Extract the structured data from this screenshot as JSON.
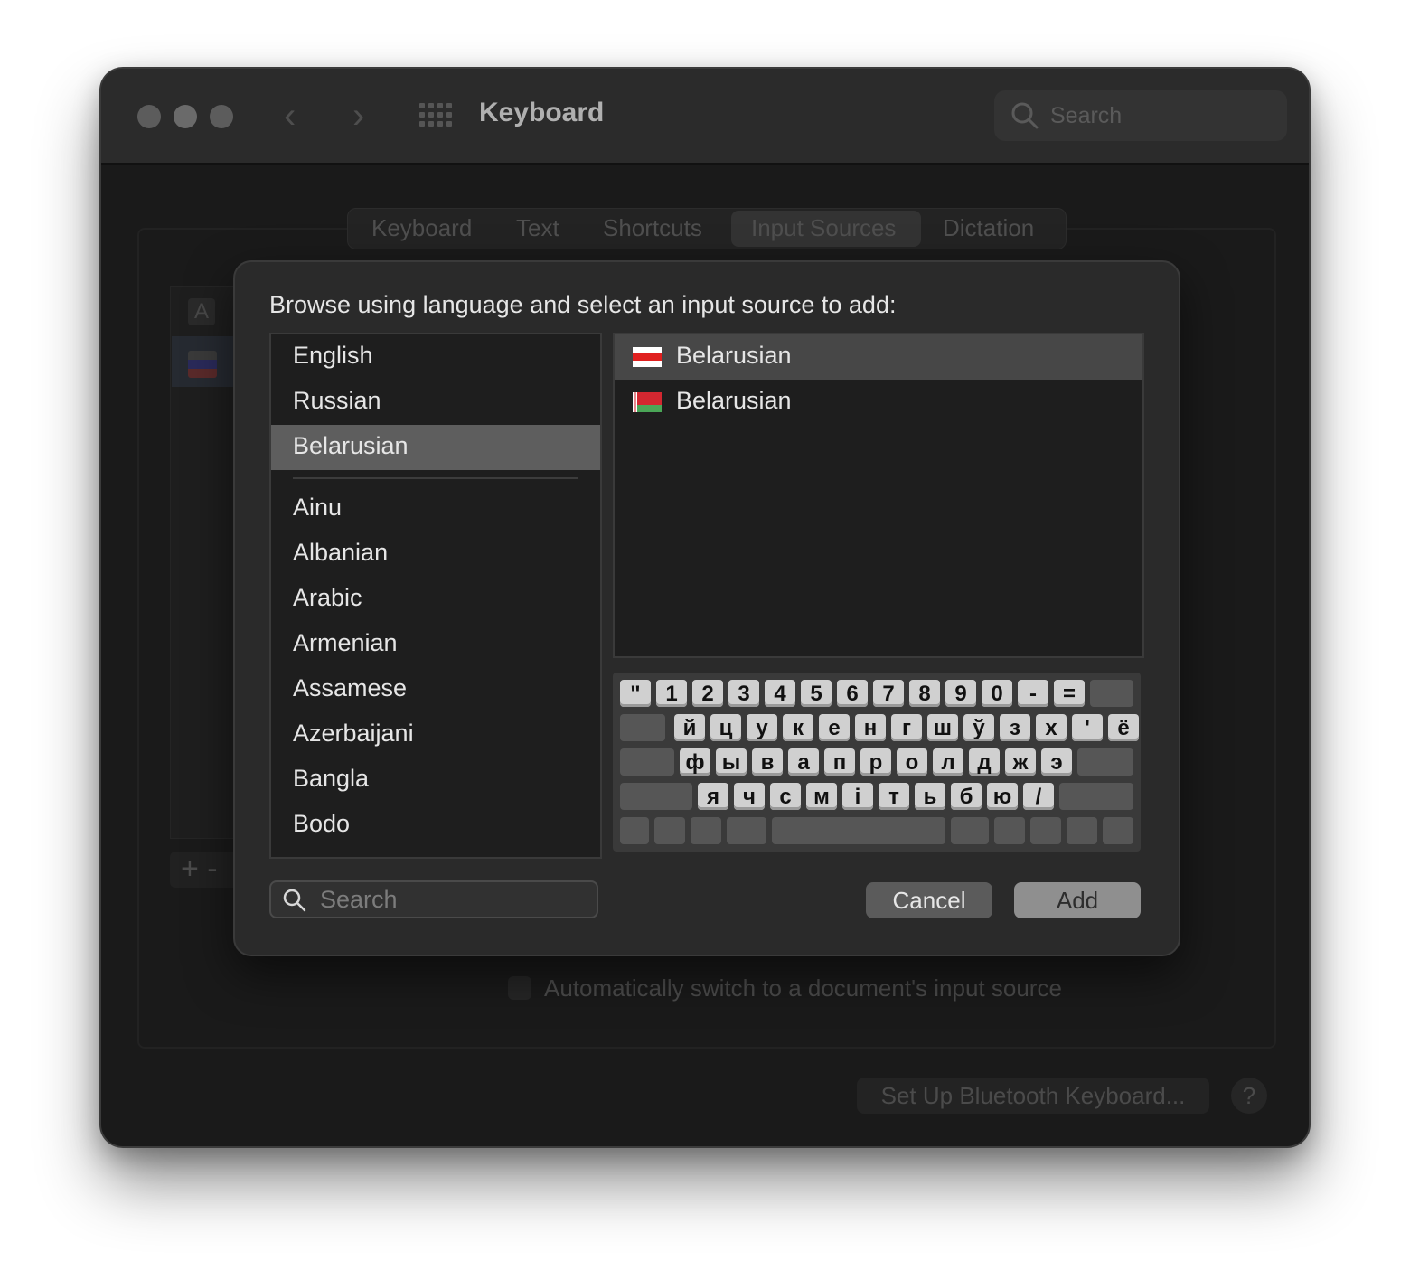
{
  "window": {
    "title": "Keyboard",
    "search_placeholder": "Search"
  },
  "tabs": [
    "Keyboard",
    "Text",
    "Shortcuts",
    "Input Sources",
    "Dictation"
  ],
  "active_tab": "Input Sources",
  "background": {
    "input_a_label": "A",
    "add_remove": "+ -",
    "auto_switch_label": "Automatically switch to a document's input source",
    "bluetooth_button": "Set Up Bluetooth Keyboard...",
    "help_label": "?"
  },
  "sheet": {
    "prompt": "Browse using language and select an input source to add:",
    "languages_top": [
      "English",
      "Russian",
      "Belarusian"
    ],
    "languages_rest": [
      "Ainu",
      "Albanian",
      "Arabic",
      "Armenian",
      "Assamese",
      "Azerbaijani",
      "Bangla",
      "Bodo"
    ],
    "selected_language": "Belarusian",
    "sources": [
      {
        "label": "Belarusian",
        "flag": "white-red-white",
        "selected": true
      },
      {
        "label": "Belarusian",
        "flag": "red-green-official",
        "selected": false
      }
    ],
    "keyboard_rows": [
      [
        "\"",
        "1",
        "2",
        "3",
        "4",
        "5",
        "6",
        "7",
        "8",
        "9",
        "0",
        "-",
        "="
      ],
      [
        "й",
        "ц",
        "у",
        "к",
        "е",
        "н",
        "г",
        "ш",
        "ў",
        "з",
        "х",
        "'",
        "ё"
      ],
      [
        "ф",
        "ы",
        "в",
        "а",
        "п",
        "р",
        "о",
        "л",
        "д",
        "ж",
        "э"
      ],
      [
        "я",
        "ч",
        "с",
        "м",
        "і",
        "т",
        "ь",
        "б",
        "ю",
        "/"
      ]
    ],
    "search_placeholder": "Search",
    "cancel_label": "Cancel",
    "add_label": "Add"
  },
  "colors": {
    "selection_gray": "#5e5e5e",
    "source_selection": "#474747",
    "window_bg": "#1a1a1a",
    "sheet_bg": "#2a2a2a"
  }
}
